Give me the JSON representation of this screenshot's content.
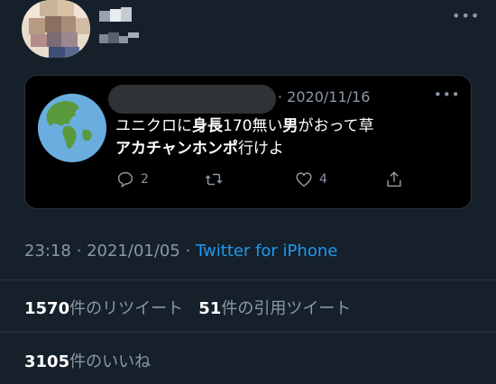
{
  "tweet": {
    "more_glyph": "•••",
    "quoted": {
      "date": "· 2020/11/16",
      "more_glyph": "•••",
      "line1": {
        "a": "ユニクロに",
        "b": "身長",
        "c": "170無い",
        "d": "男",
        "e": "がおって草"
      },
      "line2": {
        "a": "アカチャンホンポ",
        "b": "行けよ"
      },
      "reply_count": "2",
      "retweet_count": "",
      "like_count": "4",
      "icons": [
        "reply-icon",
        "retweet-icon",
        "like-icon",
        "share-icon"
      ]
    },
    "meta": {
      "time": "23:18",
      "sep": "·",
      "date": "2021/01/05",
      "app": "Twitter for iPhone"
    },
    "stats": {
      "retweets_num": "1570",
      "retweets_label": "件のリツイート",
      "quotes_num": "51",
      "quotes_label": "件の引用ツイート",
      "likes_num": "3105",
      "likes_label": "件のいいね"
    }
  },
  "colors": {
    "background": "#15202b",
    "quote_background": "#000000",
    "secondary_text": "#8b98a5",
    "link": "#1d9bf0",
    "divider": "#2f3336"
  }
}
